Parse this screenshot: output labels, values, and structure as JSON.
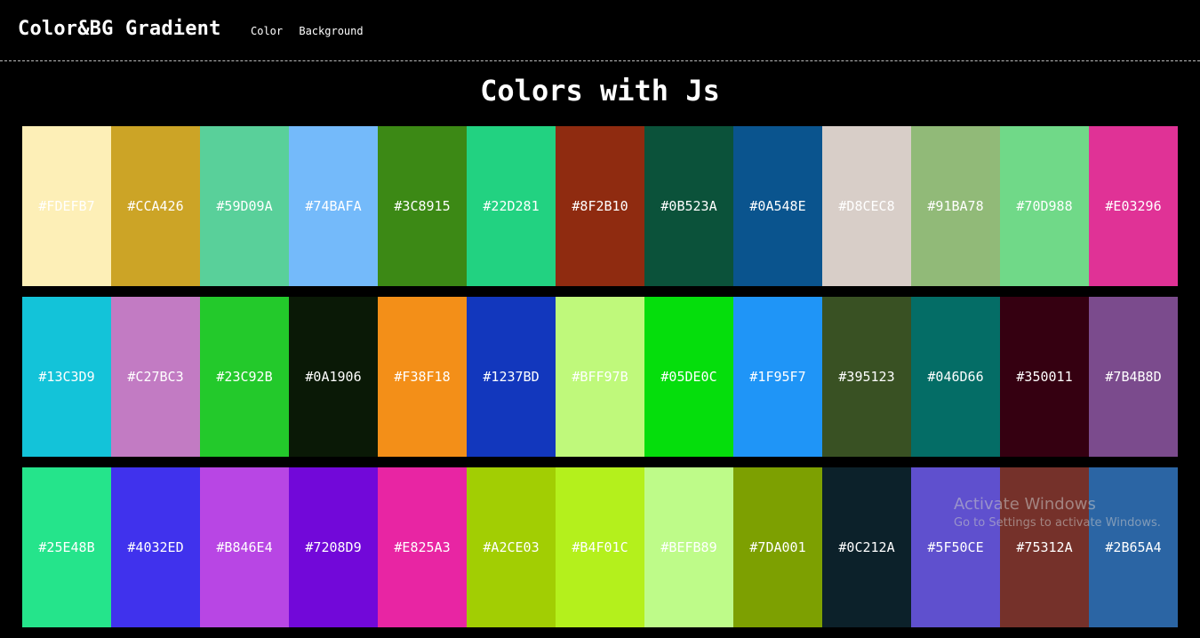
{
  "nav": {
    "brand": "Color&BG Gradient",
    "links": [
      "Color",
      "Background"
    ]
  },
  "main": {
    "title": "Colors with Js"
  },
  "palette": {
    "rows": [
      [
        "#FDEFB7",
        "#CCA426",
        "#59D09A",
        "#74BAFA",
        "#3C8915",
        "#22D281",
        "#8F2B10",
        "#0B523A",
        "#0A548E",
        "#D8CEC8",
        "#91BA78",
        "#70D988",
        "#E03296"
      ],
      [
        "#13C3D9",
        "#C27BC3",
        "#23C92B",
        "#0A1906",
        "#F38F18",
        "#1237BD",
        "#BFF97B",
        "#05DE0C",
        "#1F95F7",
        "#395123",
        "#046D66",
        "#350011",
        "#7B4B8D"
      ],
      [
        "#25E48B",
        "#4032ED",
        "#B846E4",
        "#7208D9",
        "#E825A3",
        "#A2CE03",
        "#B4F01C",
        "#BEFB89",
        "#7DA001",
        "#0C212A",
        "#5F50CE",
        "#75312A",
        "#2B65A4"
      ]
    ]
  },
  "watermark": {
    "title": "Activate Windows",
    "subtitle": "Go to Settings to activate Windows."
  }
}
